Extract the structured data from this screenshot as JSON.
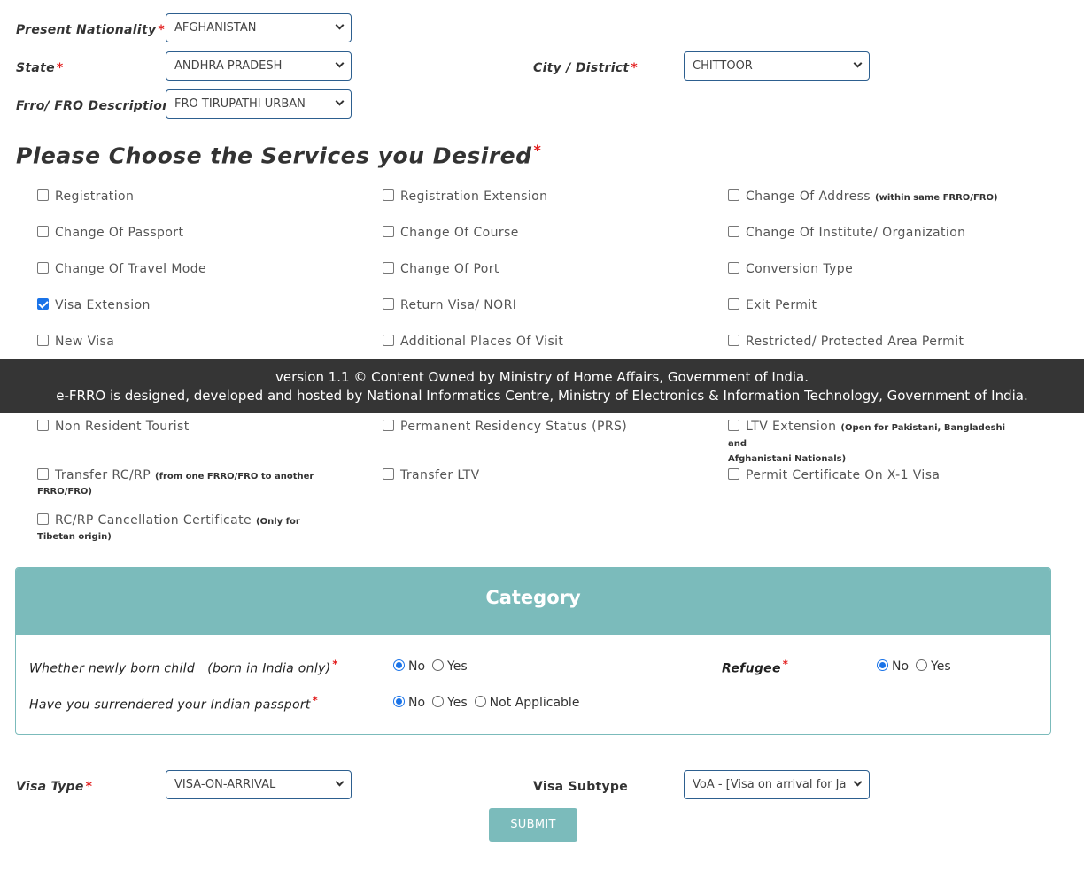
{
  "location": {
    "nationality": {
      "label": "Present Nationality",
      "value": "AFGHANISTAN"
    },
    "state": {
      "label": "State",
      "value": "ANDHRA PRADESH"
    },
    "city": {
      "label": "City / District",
      "value": "CHITTOOR"
    },
    "frro": {
      "label": "Frro/ FRO Description",
      "value": "FRO TIRUPATHI URBAN"
    },
    "required_mark": "*"
  },
  "services": {
    "heading": "Please Choose the Services you Desired",
    "items": [
      {
        "label": "Registration",
        "note": "",
        "checked": false
      },
      {
        "label": "Registration Extension",
        "note": "",
        "checked": false
      },
      {
        "label": "Change Of Address",
        "note": "(within same FRRO/FRO)",
        "checked": false
      },
      {
        "label": "Change Of Passport",
        "note": "",
        "checked": false
      },
      {
        "label": "Change Of Course",
        "note": "",
        "checked": false
      },
      {
        "label": "Change Of Institute/ Organization",
        "note": "",
        "checked": false
      },
      {
        "label": "Change Of Travel Mode",
        "note": "",
        "checked": false
      },
      {
        "label": "Change Of Port",
        "note": "",
        "checked": false
      },
      {
        "label": "Conversion Type",
        "note": "",
        "checked": false
      },
      {
        "label": "Visa Extension",
        "note": "",
        "checked": true
      },
      {
        "label": "Return Visa/ NORI",
        "note": "",
        "checked": false
      },
      {
        "label": "Exit Permit",
        "note": "",
        "checked": false
      },
      {
        "label": "New Visa",
        "note": "",
        "checked": false
      },
      {
        "label": "Additional Places Of Visit",
        "note": "",
        "checked": false
      },
      {
        "label": "Restricted/ Protected Area Permit",
        "note": "",
        "checked": false
      },
      {
        "label": "Non Resident Tourist",
        "note": "",
        "checked": false
      },
      {
        "label": "Permanent Residency Status (PRS)",
        "note": "",
        "checked": false
      },
      {
        "label": "LTV Extension",
        "note": "(Open for Pakistani, Bangladeshi and",
        "note2": "Afghanistani Nationals)",
        "checked": false
      },
      {
        "label": "Transfer RC/RP",
        "note": "(from one FRRO/FRO to another",
        "note2": "FRRO/FRO)",
        "checked": false
      },
      {
        "label": "Transfer LTV",
        "note": "",
        "checked": false
      },
      {
        "label": "Permit Certificate On X-1 Visa",
        "note": "",
        "checked": false
      },
      {
        "label": "RC/RP Cancellation Certificate",
        "note": "(Only for",
        "note2": "Tibetan origin)",
        "checked": false
      }
    ]
  },
  "footer": {
    "line1": "version 1.1 © Content Owned by Ministry of Home Affairs, Government of India.",
    "line2": "e-FRRO is designed, developed and hosted by National Informatics Centre, Ministry of Electronics & Information Technology, Government of India."
  },
  "category": {
    "title": "Category",
    "newborn": {
      "question": "Whether newly born child   (born in India only)",
      "options": [
        "No",
        "Yes"
      ],
      "selected": "No"
    },
    "refugee": {
      "question": "Refugee",
      "options": [
        "No",
        "Yes"
      ],
      "selected": "No"
    },
    "surrendered": {
      "question": "Have you surrendered your Indian passport",
      "options": [
        "No",
        "Yes",
        "Not Applicable"
      ],
      "selected": "No"
    }
  },
  "visa": {
    "type": {
      "label": "Visa Type",
      "value": "VISA-ON-ARRIVAL"
    },
    "subtype": {
      "label": "Visa Subtype",
      "value": "VoA - [Visa on arrival for Ja"
    },
    "submit_label": "SUBMIT"
  },
  "colors": {
    "accent": "#7bbbbb",
    "footer_bg": "#353535",
    "required": "#e21b1b",
    "check": "#1a73e8"
  }
}
